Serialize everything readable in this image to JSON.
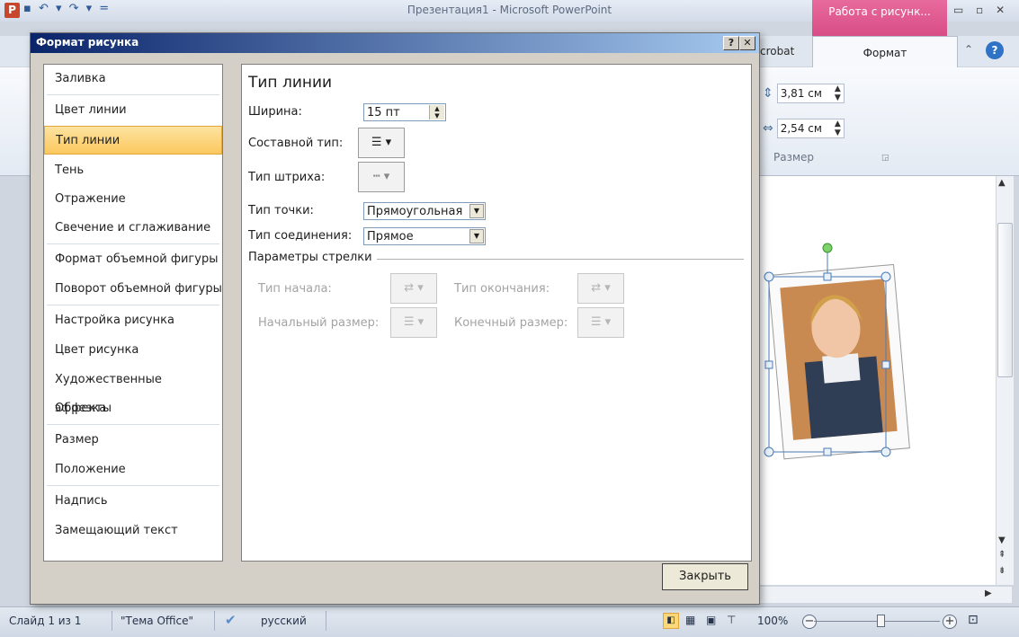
{
  "window": {
    "title": "Презентация1 - Microsoft PowerPoint",
    "app_icon": "P",
    "quick_access": "▪ ↶ ▾ ↷ ▾ ="
  },
  "ribbon": {
    "context_tab": "Работа с рисунк...",
    "tabs": {
      "acrobat": "crobat",
      "format": "Формат"
    },
    "window_controls": "▭ ▫ ✕",
    "help": "?",
    "size_group": {
      "label": "Размер",
      "height_value": "3,81 см",
      "width_value": "2,54 см"
    }
  },
  "dialog": {
    "title": "Формат рисунка",
    "help_btn": "?",
    "close_x": "✕",
    "nav": [
      {
        "label": "Заливка"
      },
      {
        "label": "Цвет линии"
      },
      {
        "label": "Тип линии",
        "selected": true
      },
      {
        "label": "Тень"
      },
      {
        "label": "Отражение"
      },
      {
        "label": "Свечение и сглаживание"
      },
      {
        "label": "Формат объемной фигуры"
      },
      {
        "label": "Поворот объемной фигуры"
      },
      {
        "label": "Настройка рисунка"
      },
      {
        "label": "Цвет рисунка"
      },
      {
        "label": "Художественные эффекты"
      },
      {
        "label": "Обрезка"
      },
      {
        "label": "Размер"
      },
      {
        "label": "Положение"
      },
      {
        "label": "Надпись"
      },
      {
        "label": "Замещающий текст"
      }
    ],
    "content": {
      "heading": "Тип линии",
      "width_label": "Ширина:",
      "width_value": "15 пт",
      "compound_label": "Составной тип:",
      "dash_label": "Тип штриха:",
      "cap_label": "Тип точки:",
      "cap_value": "Прямоугольная",
      "join_label": "Тип соединения:",
      "join_value": "Прямое",
      "arrow_section": "Параметры стрелки",
      "begin_type": "Тип начала:",
      "end_type": "Тип окончания:",
      "begin_size": "Начальный размер:",
      "end_size": "Конечный размер:"
    },
    "close_button": "Закрыть"
  },
  "statusbar": {
    "slide": "Слайд 1 из 1",
    "theme": "\"Тема Office\"",
    "language": "русский",
    "zoom": "100%"
  },
  "colors": {
    "accent_selected": "#fbc85e",
    "context_tab": "#d84d87",
    "dialog_title": "#0a246a"
  }
}
